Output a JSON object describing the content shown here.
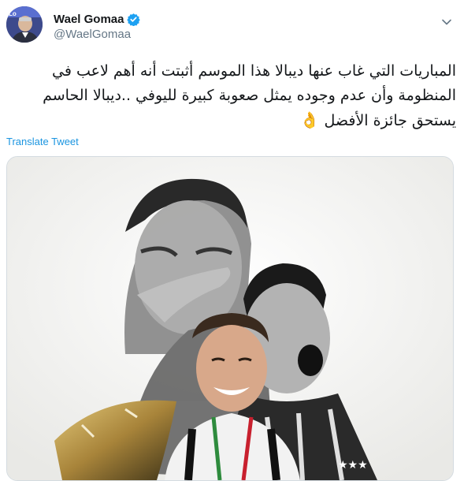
{
  "author": {
    "display_name": "Wael Gomaa",
    "handle": "@WaelGomaa",
    "verified": true,
    "verified_icon": "verified-badge-icon",
    "avatar_icon": "avatar"
  },
  "tweet": {
    "text": "المباريات التي غاب عنها ديبالا هذا الموسم أثبتت أنه أهم لاعب في المنظومة وأن عدم وجوده يمثل صعوبة كبيرة لليوفي ..ديبالا الحاسم يستحق جائزة الأفضل",
    "emoji": "👌",
    "translate_label": "Translate Tweet"
  },
  "media": {
    "description_icon": "tweet-photo"
  },
  "colors": {
    "link": "#1b95e0",
    "verified": "#1da1f2",
    "secondary_text": "#657786"
  }
}
